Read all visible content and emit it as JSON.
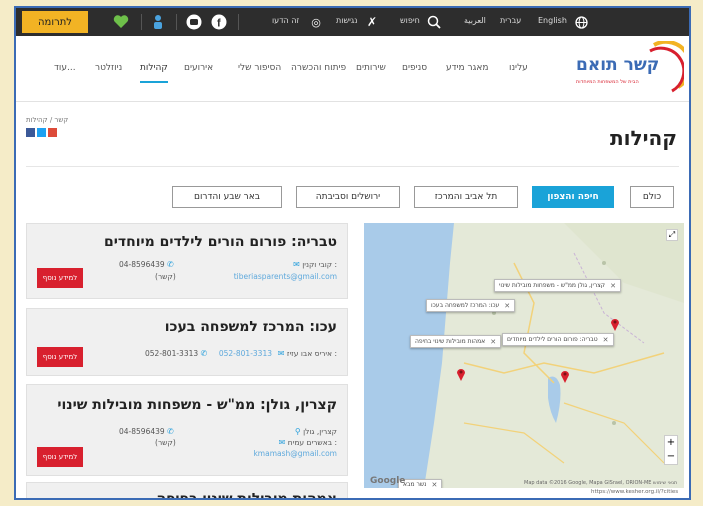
{
  "topbar": {
    "donate": "לתרומה",
    "links": {
      "english": "English",
      "hebrew": "עברית",
      "arabic": "العربية",
      "search": "חיפוש",
      "accessibility": "נגישות",
      "bidi": "זה הדעו"
    }
  },
  "logo": {
    "name": "קשר תואם",
    "tagline": "הבית של המשפחות המיוחדות"
  },
  "nav": {
    "items": [
      "עלינו",
      "מאגר מידע",
      "סניפים",
      "שירותים",
      "פיתוח והכשרה",
      "הסיפור שלי",
      "אירועים",
      "קהילות",
      "ניוזלטר",
      "עוד..."
    ],
    "active": "קהילות"
  },
  "page": {
    "breadcrumb": "קשר / קהילות",
    "title": "קהילות"
  },
  "filters": [
    "כולם",
    "חיפה והצפון",
    "תל אביב והמרכז",
    "ירושלים וסביבתה",
    "באר שבע והדרום"
  ],
  "cards": [
    {
      "title": "טבריה: פורום הורים לילדים מיוחדים",
      "contact": "קובי וקנין :",
      "email": "tiberiasparents@gmail.com",
      "phone": "04-8596439",
      "phone_note": "(קשר)",
      "button": "למידע נוסף"
    },
    {
      "title": "עכו: המרכז למשפחה בעכו",
      "contact": "איריס אבו עזיז :",
      "email": "052-801-3313",
      "phone": "052-801-3313",
      "phone_note": "",
      "button": "למידע נוסף"
    },
    {
      "title": "קצרין, גולן: ממ\"ש - משפחות מובילות שינוי",
      "location": "קצרין, גולן",
      "contact": "באשרים עמיח :",
      "email": "kmamash@gmail.com",
      "phone": "04-8596439",
      "phone_note": "(קשר)",
      "button": "למידע נוסף"
    },
    {
      "title": "אמהות מובילות שינוי בחיפה"
    }
  ],
  "map": {
    "popups": [
      "קצרין, גולן ממ\"ש - משפחות מובילות שינוי",
      "עכו: המרכז למשפחה בעכו",
      "טבריה: פורום הורים לילדים מיוחדים",
      "אמהות מובילות שינוי בחיפה",
      "נשר מבא"
    ],
    "footer": "Map data ©2016 Google, Mapa GISrael, ORION-ME  תנאי שימוש",
    "google": "Google",
    "zoom_in": "+",
    "zoom_out": "−"
  },
  "statusbar": "https://www.kesher.org.il/?cities",
  "colors": {
    "accent": "#1aa3d8",
    "button_red": "#d8202e",
    "donate": "#f2b324",
    "topbar": "#2d2d2d"
  }
}
